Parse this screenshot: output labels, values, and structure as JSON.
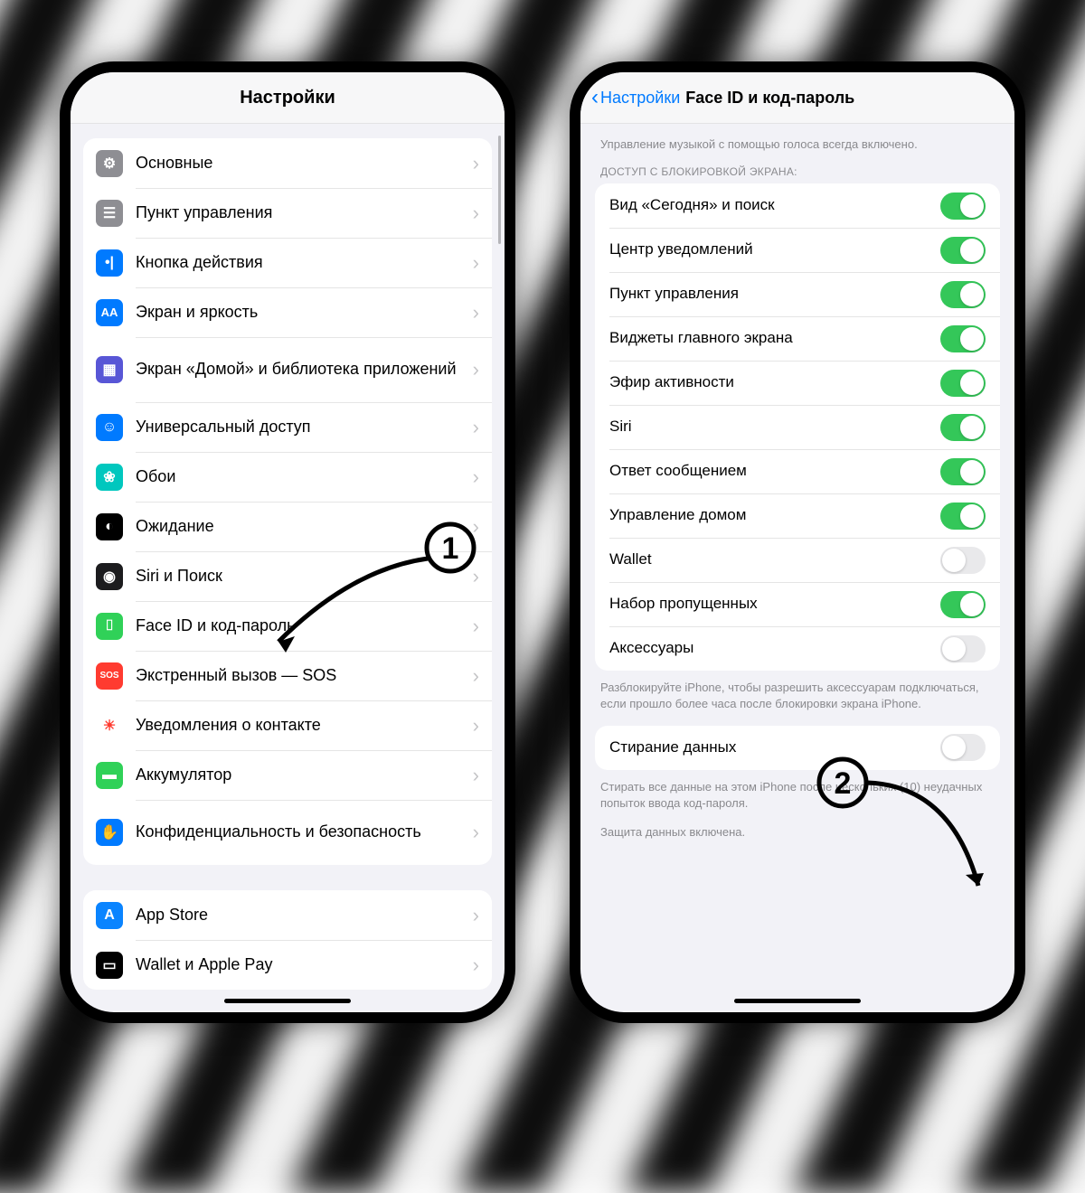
{
  "left": {
    "page_title": "Настройки",
    "group1": [
      {
        "label": "Основные",
        "icon_bg": "#8e8e93",
        "glyph": "⚙"
      },
      {
        "label": "Пункт управления",
        "icon_bg": "#8e8e93",
        "glyph": "☰"
      },
      {
        "label": "Кнопка действия",
        "icon_bg": "#007aff",
        "glyph": "•|"
      },
      {
        "label": "Экран и яркость",
        "icon_bg": "#007aff",
        "glyph": "AA"
      },
      {
        "label": "Экран «Домой» и библиотека приложений",
        "icon_bg": "#5856d6",
        "glyph": "▦",
        "big": true
      },
      {
        "label": "Универсальный доступ",
        "icon_bg": "#007aff",
        "glyph": "☺"
      },
      {
        "label": "Обои",
        "icon_bg": "#00c7be",
        "glyph": "❀"
      },
      {
        "label": "Ожидание",
        "icon_bg": "#000000",
        "glyph": "◐"
      },
      {
        "label": "Siri и Поиск",
        "icon_bg": "#1c1c1e",
        "glyph": "◉"
      },
      {
        "label": "Face ID и код-пароль",
        "icon_bg": "#30d158",
        "glyph": "⌷"
      },
      {
        "label": "Экстренный вызов — SOS",
        "icon_bg": "#ff3b30",
        "glyph": "SOS"
      },
      {
        "label": "Уведомления о контакте",
        "icon_bg": "#ffffff",
        "glyph": "☀",
        "fg": "#ff3b30"
      },
      {
        "label": "Аккумулятор",
        "icon_bg": "#30d158",
        "glyph": "▬"
      },
      {
        "label": "Конфиденциальность и безопасность",
        "icon_bg": "#007aff",
        "glyph": "✋",
        "big": true
      }
    ],
    "group2": [
      {
        "label": "App Store",
        "icon_bg": "#0a84ff",
        "glyph": "A"
      },
      {
        "label": "Wallet и Apple Pay",
        "icon_bg": "#000000",
        "glyph": "▭"
      }
    ]
  },
  "right": {
    "back_label": "Настройки",
    "page_title": "Face ID и код-пароль",
    "intro": "Управление музыкой с помощью голоса всегда включено.",
    "section_header": "ДОСТУП С БЛОКИРОВКОЙ ЭКРАНА:",
    "toggles": [
      {
        "label": "Вид «Сегодня» и поиск",
        "on": true
      },
      {
        "label": "Центр уведомлений",
        "on": true
      },
      {
        "label": "Пункт управления",
        "on": true
      },
      {
        "label": "Виджеты главного экрана",
        "on": true
      },
      {
        "label": "Эфир активности",
        "on": true
      },
      {
        "label": "Siri",
        "on": true
      },
      {
        "label": "Ответ сообщением",
        "on": true
      },
      {
        "label": "Управление домом",
        "on": true
      },
      {
        "label": "Wallet",
        "on": false
      },
      {
        "label": "Набор пропущенных",
        "on": true
      },
      {
        "label": "Аксессуары",
        "on": false
      }
    ],
    "accessories_note": "Разблокируйте iPhone, чтобы разрешить аксессуарам подключаться, если прошло более часа после блокировки экрана iPhone.",
    "erase": {
      "label": "Стирание данных",
      "on": false
    },
    "erase_note": "Стирать все данные на этом iPhone после нескольких (10) неудачных попыток ввода код-пароля.",
    "protection": "Защита данных включена."
  },
  "annotations": {
    "a1": "1",
    "a2": "2"
  }
}
